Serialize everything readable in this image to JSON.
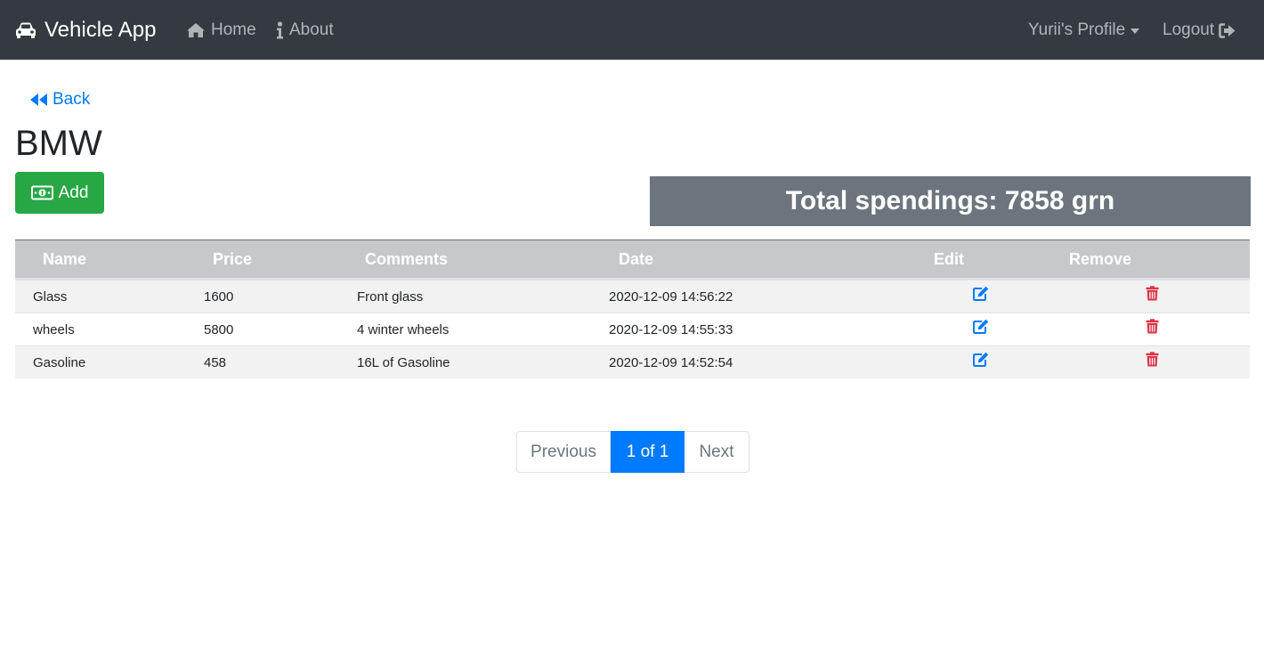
{
  "navbar": {
    "brand": "Vehicle App",
    "home": "Home",
    "about": "About",
    "profile": "Yurii's Profile",
    "logout": "Logout"
  },
  "back_label": "Back",
  "vehicle_name": "BMW",
  "add_label": "Add",
  "total_spendings": "Total spendings: 7858 grn",
  "table": {
    "headers": [
      "Name",
      "Price",
      "Comments",
      "Date",
      "Edit",
      "Remove"
    ],
    "rows": [
      {
        "name": "Glass",
        "price": "1600",
        "comments": "Front glass",
        "date": "2020-12-09 14:56:22"
      },
      {
        "name": "wheels",
        "price": "5800",
        "comments": "4 winter wheels",
        "date": "2020-12-09 14:55:33"
      },
      {
        "name": "Gasoline",
        "price": "458",
        "comments": "16L of Gasoline",
        "date": "2020-12-09 14:52:54"
      }
    ]
  },
  "pagination": {
    "previous": "Previous",
    "current": "1 of 1",
    "next": "Next"
  },
  "icons": {
    "brand": "car-icon",
    "home": "home-icon",
    "about": "info-icon",
    "logout": "sign-out-icon",
    "back": "backward-icon",
    "add": "money-bill-icon",
    "edit": "edit-icon",
    "remove": "trash-icon"
  },
  "colors": {
    "navbar": "#343a40",
    "primary": "#007bff",
    "success": "#28a745",
    "danger": "#dc3545",
    "secondary": "#6c757d"
  }
}
